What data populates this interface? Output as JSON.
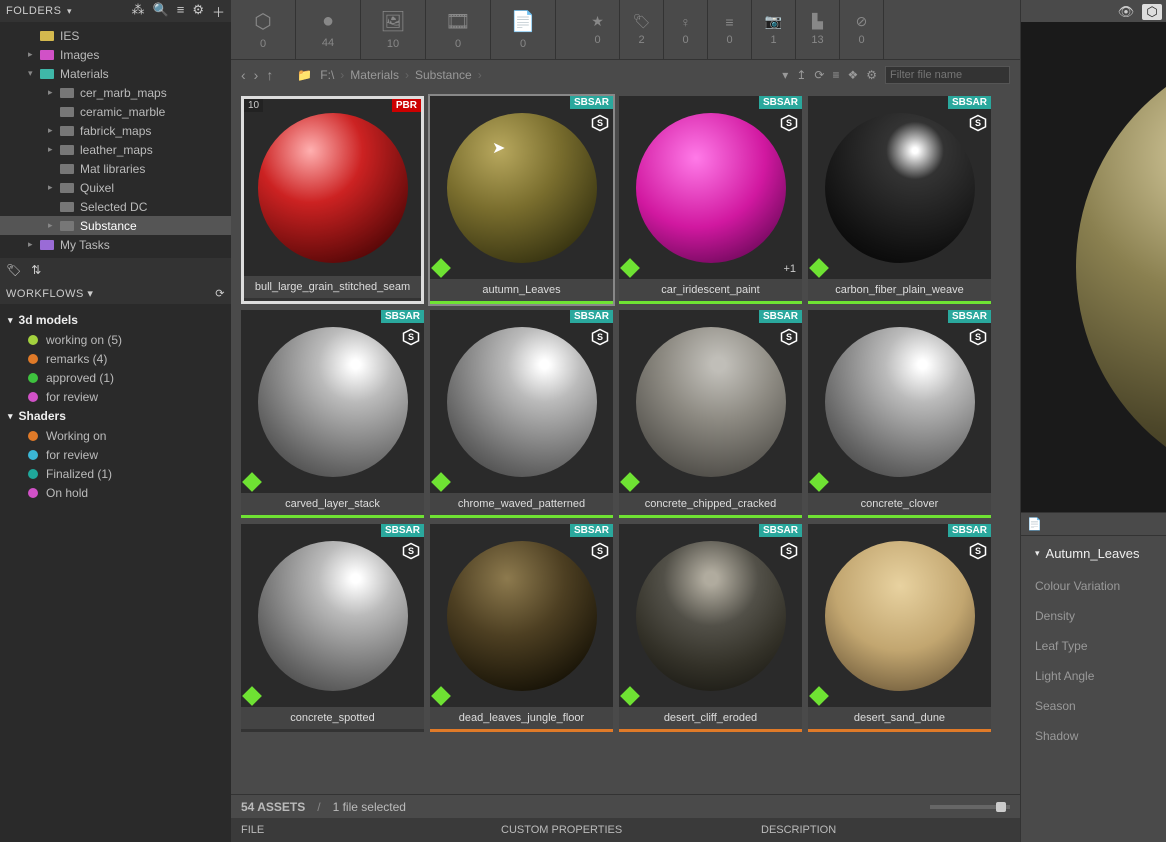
{
  "left": {
    "folders_label": "FOLDERS",
    "tree": [
      {
        "label": "IES",
        "indent": 28,
        "arrow": "",
        "color": "#d4b94e"
      },
      {
        "label": "Images",
        "indent": 28,
        "arrow": "▸",
        "color": "#d151c7"
      },
      {
        "label": "Materials",
        "indent": 28,
        "arrow": "▾",
        "color": "#3fb7a8"
      },
      {
        "label": "cer_marb_maps",
        "indent": 48,
        "arrow": "▸",
        "color": "#777"
      },
      {
        "label": "ceramic_marble",
        "indent": 48,
        "arrow": "",
        "color": "#777"
      },
      {
        "label": "fabrick_maps",
        "indent": 48,
        "arrow": "▸",
        "color": "#777"
      },
      {
        "label": "leather_maps",
        "indent": 48,
        "arrow": "▸",
        "color": "#777"
      },
      {
        "label": "Mat libraries",
        "indent": 48,
        "arrow": "",
        "color": "#777"
      },
      {
        "label": "Quixel",
        "indent": 48,
        "arrow": "▸",
        "color": "#777"
      },
      {
        "label": "Selected DC",
        "indent": 48,
        "arrow": "",
        "color": "#777"
      },
      {
        "label": "Substance",
        "indent": 48,
        "arrow": "▸",
        "color": "#777",
        "selected": true
      },
      {
        "label": "My Tasks",
        "indent": 28,
        "arrow": "▸",
        "color": "#9a6bd6"
      }
    ],
    "workflows_label": "WORKFLOWS",
    "wf": [
      {
        "type": "group",
        "label": "3d models"
      },
      {
        "type": "item",
        "dot": "#a3d23e",
        "label": "working on  (5)"
      },
      {
        "type": "item",
        "dot": "#e07a28",
        "label": "remarks  (4)"
      },
      {
        "type": "item",
        "dot": "#3ec23e",
        "label": "approved  (1)"
      },
      {
        "type": "item",
        "dot": "#d151c7",
        "label": "for review"
      },
      {
        "type": "group",
        "label": "Shaders"
      },
      {
        "type": "item",
        "dot": "#e07a28",
        "label": "Working on"
      },
      {
        "type": "item",
        "dot": "#3bb7d6",
        "label": "for review"
      },
      {
        "type": "item",
        "dot": "#1fa89b",
        "label": "Finalized  (1)"
      },
      {
        "type": "item",
        "dot": "#d151c7",
        "label": "On hold"
      }
    ]
  },
  "toolbar": {
    "large": [
      {
        "icon": "⬡",
        "count": "0"
      },
      {
        "icon": "●",
        "count": "44"
      },
      {
        "icon": "🖼",
        "count": "10"
      },
      {
        "icon": "🎞",
        "count": "0"
      },
      {
        "icon": "📄",
        "count": "0"
      }
    ],
    "small": [
      {
        "icon": "★",
        "count": "0"
      },
      {
        "icon": "🏷",
        "count": "2"
      },
      {
        "icon": "♀",
        "count": "0"
      },
      {
        "icon": "≡",
        "count": "0"
      },
      {
        "icon": "📷",
        "count": "1"
      },
      {
        "icon": "▙",
        "count": "13"
      },
      {
        "icon": "⊘",
        "count": "0"
      }
    ]
  },
  "nav": {
    "crumbs": [
      "F:\\",
      "Materials",
      "Substance"
    ],
    "filter_placeholder": "Filter file name"
  },
  "assets": [
    {
      "name": "bull_large_grain_stitched_seam",
      "badge": "PBR",
      "badge_count": "10",
      "sphere": "red",
      "first": true
    },
    {
      "name": "autumn_Leaves",
      "badge": "SBSAR",
      "sphere": "olive",
      "underline": "#6fe233",
      "selected": true,
      "cursor": true
    },
    {
      "name": "car_iridescent_paint",
      "badge": "SBSAR",
      "sphere": "magenta",
      "underline": "#6fe233",
      "plus": "+1"
    },
    {
      "name": "carbon_fiber_plain_weave",
      "badge": "SBSAR",
      "sphere": "dark",
      "underline": "#6fe233"
    },
    {
      "name": "carved_layer_stack",
      "badge": "SBSAR",
      "sphere": "grey",
      "underline": "#6fe233"
    },
    {
      "name": "chrome_waved_patterned",
      "badge": "SBSAR",
      "sphere": "grey",
      "underline": "#6fe233"
    },
    {
      "name": "concrete_chipped_cracked",
      "badge": "SBSAR",
      "sphere": "concrete",
      "underline": "#6fe233"
    },
    {
      "name": "concrete_clover",
      "badge": "SBSAR",
      "sphere": "grey",
      "underline": "#6fe233"
    },
    {
      "name": "concrete_spotted",
      "badge": "SBSAR",
      "sphere": "grey",
      "underline": ""
    },
    {
      "name": "dead_leaves_jungle_floor",
      "badge": "SBSAR",
      "sphere": "darkmud",
      "underline": "#e07a28"
    },
    {
      "name": "desert_cliff_eroded",
      "badge": "SBSAR",
      "sphere": "cliff",
      "underline": "#e07a28"
    },
    {
      "name": "desert_sand_dune",
      "badge": "SBSAR",
      "sphere": "dune",
      "underline": "#e07a28"
    }
  ],
  "status": {
    "assets": "54 ASSETS",
    "selected": "1 file selected"
  },
  "table_headers": {
    "file": "FILE",
    "custom": "CUSTOM PROPERTIES",
    "desc": "DESCRIPTION"
  },
  "right": {
    "title": "Autumn_Leaves",
    "props": [
      "Colour Variation",
      "Density",
      "Leaf Type",
      "Light Angle",
      "Season",
      "Shadow"
    ]
  }
}
